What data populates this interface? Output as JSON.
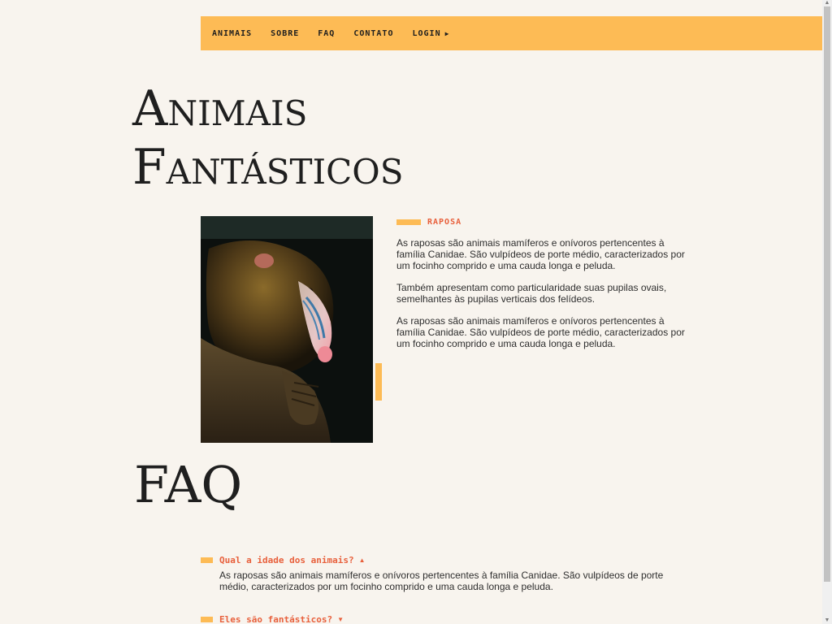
{
  "nav": {
    "items": [
      {
        "label": "ANIMAIS"
      },
      {
        "label": "SOBRE"
      },
      {
        "label": "FAQ"
      },
      {
        "label": "CONTATO"
      },
      {
        "label": "LOGIN",
        "icon": "caret-right-icon"
      }
    ]
  },
  "title": {
    "line1": "Animais",
    "line2": "Fantásticos"
  },
  "animal": {
    "name": "RAPOSA",
    "image": "mandrill-photo",
    "paragraphs": [
      "As raposas são animais mamíferos e onívoros pertencentes à família Canidae. São vulpídeos de porte médio, caracterizados por um focinho comprido e uma cauda longa e peluda.",
      "Também apresentam como particularidade suas pupilas ovais, semelhantes às pupilas verticais dos felídeos.",
      "As raposas são animais mamíferos e onívoros pertencentes à família Canidae. São vulpídeos de porte médio, caracterizados por um focinho comprido e uma cauda longa e peluda."
    ]
  },
  "faq": {
    "title": "FAQ",
    "items": [
      {
        "question": "Qual a idade dos animais?",
        "arrow": "▲",
        "answer": "As raposas são animais mamíferos e onívoros pertencentes à família Canidae. São vulpídeos de porte médio, caracterizados por um focinho comprido e uma cauda longa e peluda."
      },
      {
        "question": "Eles são fantásticos?",
        "arrow": "▼"
      }
    ]
  },
  "colors": {
    "accent": "#fdbb55",
    "highlight": "#e8603c",
    "background": "#f8f4ee"
  }
}
